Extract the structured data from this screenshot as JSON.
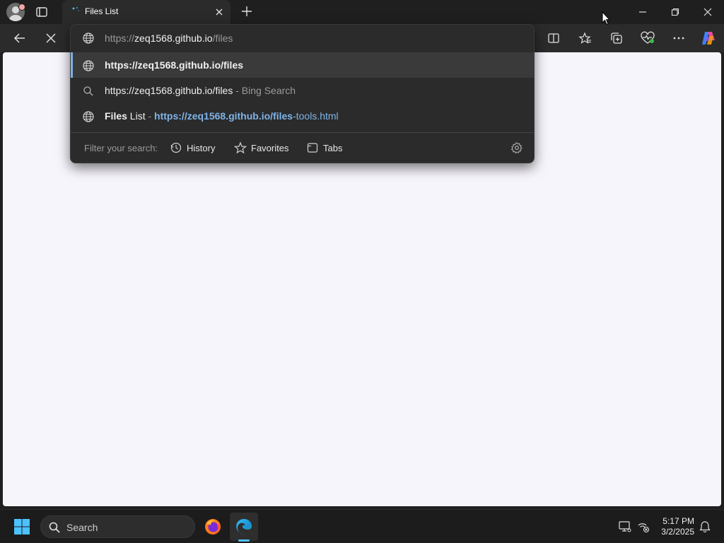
{
  "browser": {
    "tab": {
      "title": "Files List",
      "loading": true
    },
    "address_bar": {
      "value_prefix": "https://",
      "value_host": "zeq1568.github.io",
      "value_path": "/files"
    }
  },
  "omnibox": {
    "suggestions": [
      {
        "icon": "globe-icon",
        "text": "https://zeq1568.github.io/files",
        "active": true
      },
      {
        "icon": "search-icon",
        "text": "https://zeq1568.github.io/files",
        "suffix": " - Bing Search"
      },
      {
        "icon": "globe-icon",
        "title_bold": "Files",
        "title_rest": " List",
        "sep": " - ",
        "url_bold": "https://zeq1568.github.io/files",
        "url_rest": "-tools.html"
      }
    ],
    "filter": {
      "label": "Filter your search:",
      "chips": [
        {
          "icon": "history-icon",
          "label": "History"
        },
        {
          "icon": "star-icon",
          "label": "Favorites"
        },
        {
          "icon": "tabs-icon",
          "label": "Tabs"
        }
      ]
    }
  },
  "taskbar": {
    "search_placeholder": "Search",
    "time": "5:17 PM",
    "date": "3/2/2025"
  },
  "colors": {
    "accent": "#7eb4ea",
    "taskbar_indicator": "#4cc2ff",
    "page_background": "#f7f5fc"
  }
}
